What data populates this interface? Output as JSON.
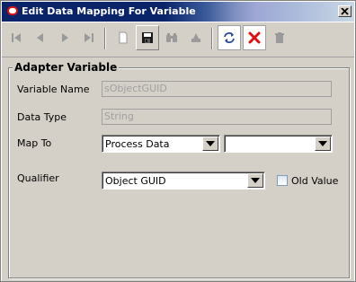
{
  "window": {
    "title": "Edit Data Mapping For Variable"
  },
  "toolbar": {
    "buttons": [
      {
        "name": "first-record",
        "icon": "first-icon",
        "enabled": false
      },
      {
        "name": "prev-record",
        "icon": "prev-icon",
        "enabled": false
      },
      {
        "name": "next-record",
        "icon": "next-icon",
        "enabled": false
      },
      {
        "name": "last-record",
        "icon": "last-icon",
        "enabled": false
      },
      {
        "name": "new-record",
        "icon": "new-document-icon",
        "enabled": false
      },
      {
        "name": "save",
        "icon": "floppy-disk-icon",
        "enabled": true
      },
      {
        "name": "find",
        "icon": "binoculars-icon",
        "enabled": false
      },
      {
        "name": "clear",
        "icon": "eraser-icon",
        "enabled": false
      },
      {
        "name": "refresh",
        "icon": "refresh-icon",
        "enabled": true
      },
      {
        "name": "cancel",
        "icon": "red-x-icon",
        "enabled": true
      },
      {
        "name": "delete",
        "icon": "trash-icon",
        "enabled": false
      }
    ]
  },
  "group": {
    "title": "Adapter Variable",
    "variable_name_label": "Variable Name",
    "variable_name_value": "sObjectGUID",
    "data_type_label": "Data Type",
    "data_type_value": "String",
    "map_to_label": "Map To",
    "map_to_value": "Process Data",
    "map_to_secondary_value": "",
    "qualifier_label": "Qualifier",
    "qualifier_value": "Object GUID",
    "old_value_label": "Old Value",
    "old_value_checked": false
  },
  "colors": {
    "title_bar": "#0a246a",
    "cancel_red": "#e01010",
    "panel": "#d4d0c8"
  }
}
